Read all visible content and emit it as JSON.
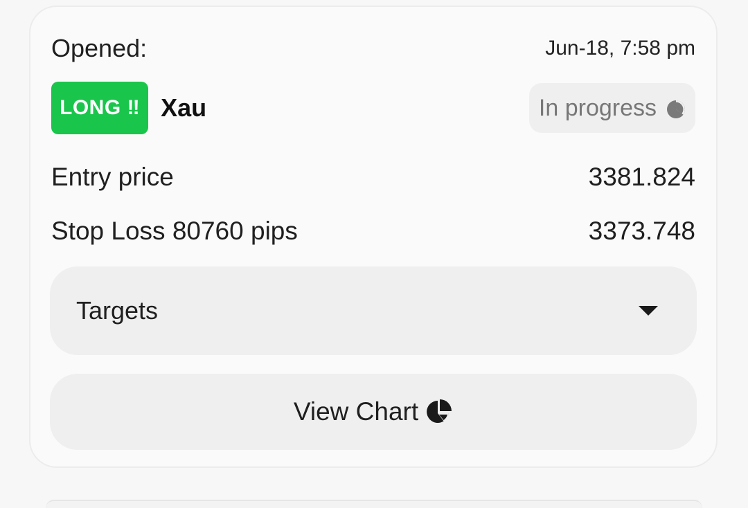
{
  "signal": {
    "opened_label": "Opened:",
    "opened_date": "Jun-18, 7:58 pm",
    "direction_badge": "LONG ‼",
    "symbol": "Xau",
    "status": "In progress",
    "status_icon": "progress-pie-icon",
    "entry_label": "Entry price",
    "entry_value": "3381.824",
    "stop_loss_label": "Stop Loss 80760 pips",
    "stop_loss_value": "3373.748",
    "targets_label": "Targets",
    "targets_icon": "chevron-down-icon",
    "view_chart_label": "View Chart",
    "view_chart_icon": "pie-chart-icon"
  },
  "colors": {
    "long_badge": "#19c54b",
    "status_pill_bg": "#efefef",
    "status_text": "#777777"
  }
}
